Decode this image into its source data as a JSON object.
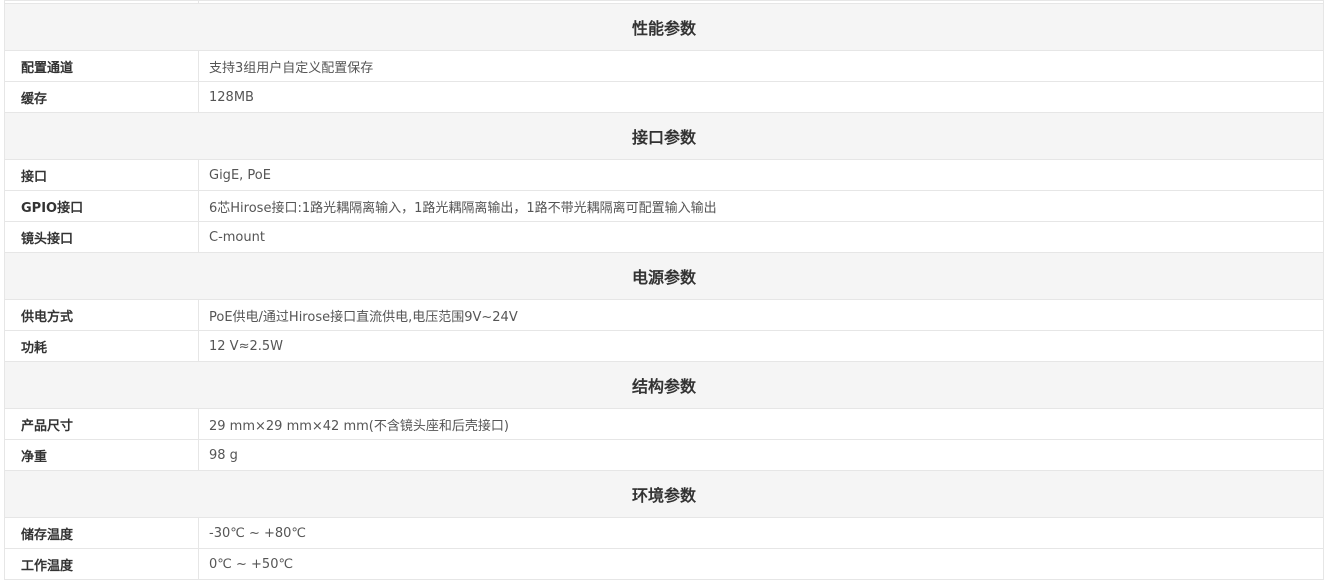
{
  "sections": [
    {
      "title": "性能参数",
      "rows": [
        {
          "label": "配置通道",
          "value": "支持3组用户自定义配置保存"
        },
        {
          "label": "缓存",
          "value": "128MB"
        }
      ]
    },
    {
      "title": "接口参数",
      "rows": [
        {
          "label": "接口",
          "value": "GigE, PoE"
        },
        {
          "label": "GPIO接口",
          "value": "6芯Hirose接口:1路光耦隔离输入，1路光耦隔离输出，1路不带光耦隔离可配置输入输出"
        },
        {
          "label": "镜头接口",
          "value": "C-mount"
        }
      ]
    },
    {
      "title": "电源参数",
      "rows": [
        {
          "label": "供电方式",
          "value": "PoE供电/通过Hirose接口直流供电,电压范围9V~24V"
        },
        {
          "label": "功耗",
          "value": "12 V≈2.5W"
        }
      ]
    },
    {
      "title": "结构参数",
      "rows": [
        {
          "label": "产品尺寸",
          "value": "29 mm×29 mm×42 mm(不含镜头座和后壳接口)"
        },
        {
          "label": "净重",
          "value": "98 g"
        }
      ]
    },
    {
      "title": "环境参数",
      "rows": [
        {
          "label": "储存温度",
          "value": "-30℃ ~ +80℃"
        },
        {
          "label": "工作温度",
          "value": "0℃ ~ +50℃"
        }
      ]
    }
  ]
}
